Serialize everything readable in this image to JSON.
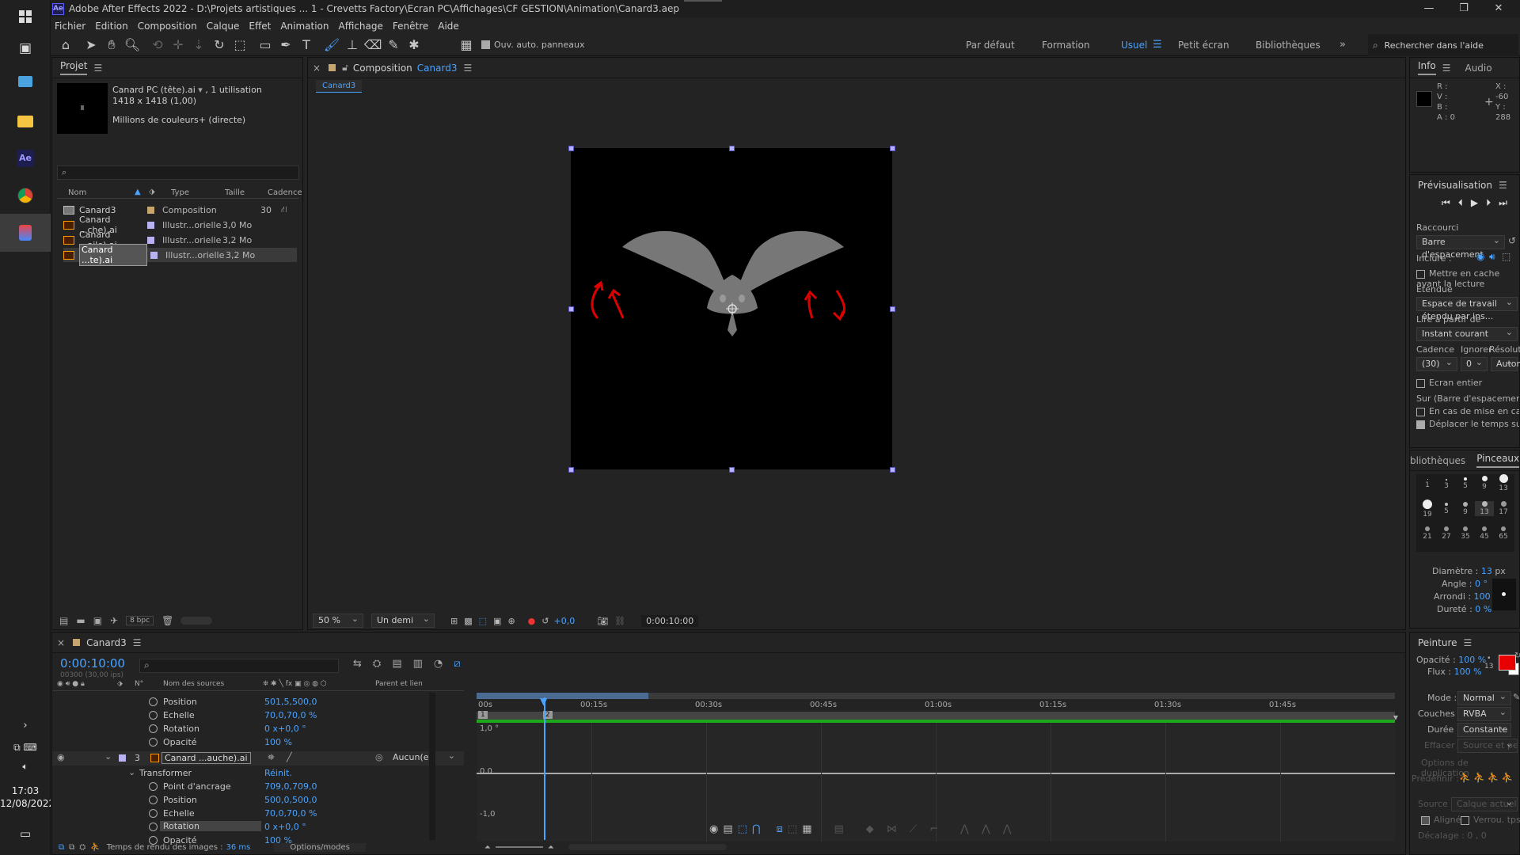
{
  "taskbar": {
    "clock_time": "17:03",
    "clock_date": "12/08/2022",
    "ae_label": "Ae"
  },
  "app": {
    "logo": "Ae",
    "title": "Adobe After Effects 2022 - D:\\Projets artistiques ... 1 - Crevetts Factory\\Ecran PC\\Affichages\\CF GESTION\\Animation\\Canard3.aep"
  },
  "menu": [
    "Fichier",
    "Edition",
    "Composition",
    "Calque",
    "Effet",
    "Animation",
    "Affichage",
    "Fenêtre",
    "Aide"
  ],
  "toolbar": {
    "auto_panels": "Ouv. auto. panneaux",
    "workspaces": [
      "Par défaut",
      "Formation",
      "Usuel",
      "Petit écran",
      "Bibliothèques"
    ],
    "active_workspace": "Usuel",
    "search_placeholder": "Rechercher dans l'aide"
  },
  "project": {
    "title": "Projet",
    "item_name": "Canard PC (tête).ai",
    "item_usage": ", 1 utilisation",
    "item_size": "1418 x 1418 (1,00)",
    "item_colors": "Millions de couleurs+ (directe)",
    "search_placeholder": "",
    "columns": [
      "Nom",
      "Type",
      "Taille",
      "Cadence"
    ],
    "rows": [
      {
        "name": "Canard3",
        "type": "Composition",
        "size": "",
        "rate": "30"
      },
      {
        "name": "Canard ...che).ai",
        "type": "Illustr...orielle",
        "size": "3,0 Mo",
        "rate": ""
      },
      {
        "name": "Canard ...aile).ai",
        "type": "Illustr...orielle",
        "size": "3,2 Mo",
        "rate": ""
      },
      {
        "name": "Canard ...te).ai",
        "type": "Illustr...orielle",
        "size": "3,2 Mo",
        "rate": ""
      }
    ],
    "bpc": "8 bpc"
  },
  "composition": {
    "panel_label": "Composition",
    "name": "Canard3",
    "tab": "Canard3",
    "zoom": "50 %",
    "resolution": "Un demi",
    "exposure": "+0,0",
    "timecode": "0:00:10:00"
  },
  "info": {
    "tab_info": "Info",
    "tab_audio": "Audio",
    "r": "R :",
    "v": "V :",
    "b": "B :",
    "a": "A : 0",
    "x": "X : -60",
    "y": "Y : 288"
  },
  "preview": {
    "title": "Prévisualisation",
    "shortcut_label": "Raccourci",
    "shortcut_value": "Barre d'espacement",
    "include_label": "Inclure :",
    "cache_label": "Mettre en cache avant la lecture",
    "range_label": "Etendue",
    "range_value": "Espace de travail étendu par ins...",
    "play_from_label": "Lire à partir de",
    "play_from_value": "Instant courant",
    "fps_label": "Cadence",
    "skip_label": "Ignorer",
    "res_label": "Résolution",
    "fps_value": "(30)",
    "skip_value": "0",
    "res_value": "Automa...",
    "fullscreen_label": "Ecran entier",
    "stop_label": "Sur (Barre d'espacement) Arrêter :",
    "stop_opt1": "En cas de mise en cache, lire les ...",
    "stop_opt2": "Déplacer le temps sur l'instant de pré"
  },
  "brushes": {
    "tab_lib": "bliothèques",
    "tab_brushes": "Pinceaux",
    "sizes": [
      "1",
      "3",
      "5",
      "9",
      "13",
      "19",
      "5",
      "9",
      "13",
      "17",
      "21",
      "27",
      "35",
      "45",
      "65"
    ],
    "diameter_label": "Diamètre :",
    "diameter_value": "13",
    "diameter_unit": "px",
    "angle_label": "Angle :",
    "angle_value": "0 °",
    "round_label": "Arrondi :",
    "round_value": "100",
    "round_unit": "%",
    "hardness_label": "Dureté :",
    "hardness_value": "0 %"
  },
  "paint": {
    "title": "Peinture",
    "opacity_label": "Opacité :",
    "opacity_value": "100 %",
    "flow_label": "Flux :",
    "flow_value": "100 %",
    "brush_size": "13",
    "mode_label": "Mode :",
    "mode_value": "Normal",
    "channels_label": "Couches :",
    "channels_value": "RVBA",
    "duration_label": "Durée :",
    "duration_value": "Constante",
    "erase_label": "Effacer :",
    "erase_value": "Source et peinture d...",
    "clone_label": "Options de duplication",
    "preset_label": "Prédéfinir :",
    "source_label": "Source :",
    "source_value": "Calque actuel",
    "aligned_label": "Aligné",
    "lock_label": "Verrou. tps source",
    "offset_label": "Décalage :",
    "offset_x": "0",
    "offset_y": "0",
    "fg_color": "#e80000",
    "bg_color": "#ffffff"
  },
  "timeline": {
    "tab": "Canard3",
    "timecode": "0:00:10:00",
    "frame_info": "00300 (30,00 ips)",
    "col_source": "Nom des sources",
    "col_parent": "Parent et lien",
    "col_num": "N°",
    "props_top": [
      {
        "name": "Position",
        "value": "501,5,500,0"
      },
      {
        "name": "Echelle",
        "value": "70,0,70,0 %"
      },
      {
        "name": "Rotation",
        "value": "0 x+0,0 °"
      },
      {
        "name": "Opacité",
        "value": "100 %"
      }
    ],
    "layer_num": "3",
    "layer_name": "Canard ...auche).ai",
    "layer_parent": "Aucun(e)",
    "transform_label": "Transformer",
    "reset_label": "Réinit.",
    "props_bottom": [
      {
        "name": "Point d'ancrage",
        "value": "709,0,709,0"
      },
      {
        "name": "Position",
        "value": "500,0,500,0"
      },
      {
        "name": "Echelle",
        "value": "70,0,70,0 %"
      },
      {
        "name": "Rotation",
        "value": "0 x+0,0 °"
      },
      {
        "name": "Opacité",
        "value": "100 %"
      }
    ],
    "ruler": [
      "00s",
      "00:15s",
      "00:30s",
      "00:45s",
      "01:00s",
      "01:15s",
      "01:30s",
      "01:45s"
    ],
    "graph_labels": [
      "1,0 °",
      "0,0",
      "-1,0"
    ],
    "marker1": "1",
    "marker2": "2",
    "render_label": "Temps de rendu des images :",
    "render_value": "36 ms",
    "options_modes": "Options/modes"
  }
}
